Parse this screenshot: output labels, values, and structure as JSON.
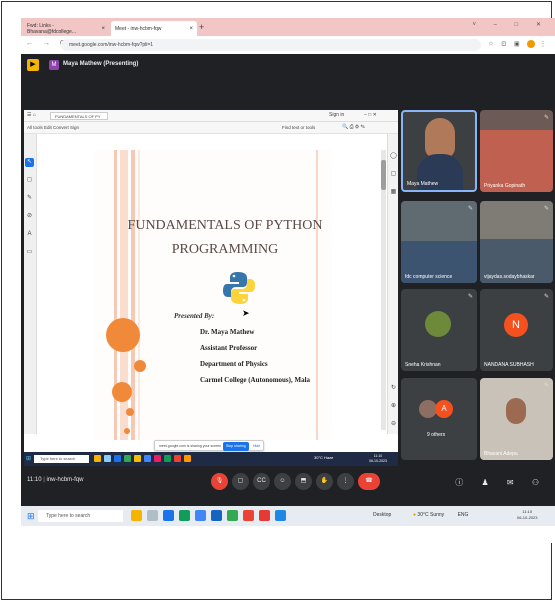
{
  "browser": {
    "tab1_title": "Fwd: Links - Bhavana@fdcollege...",
    "tab2_title": "Meet - inw-hcbm-fqw",
    "url": "meet.google.com/inw-hcbm-fqw?pli=1",
    "window_controls": "˅ – □ ✕"
  },
  "meet": {
    "presenter_initial": "M",
    "presenter_label": "Maya Mathew (Presenting)",
    "time": "11:10",
    "meeting_code": "inw-hcbm-fqw"
  },
  "pdf": {
    "tab_title": "FUNDAMENTALS OF PY",
    "signin": "Sign in",
    "menu": "All tools   Edit   Convert   Sign",
    "fit": "Find text or tools"
  },
  "slide": {
    "title_line1": "FUNDAMENTALS OF PYTHON",
    "title_line2": "PROGRAMMING",
    "presented_by": "Presented By:",
    "name": "Dr. Maya Mathew",
    "designation": "Assistant Professor",
    "department": "Department of Physics",
    "college": "Carmel College (Autonomous), Mala"
  },
  "sharebar": {
    "text": "meet.google.com is sharing your screen",
    "stop": "Stop sharing",
    "hide": "Hide"
  },
  "inner_taskbar": {
    "search": "Type here to search",
    "weather": "30°C Haze",
    "clock_time": "11:10",
    "clock_date": "06-10-2023"
  },
  "participants": [
    {
      "name": "Maya Mathew"
    },
    {
      "name": "Priyanka Gopinath"
    },
    {
      "name": "fdc computer science"
    },
    {
      "name": "vijaydas.sodaybhaskar"
    },
    {
      "name": "Sneha Krishnan"
    },
    {
      "name": "NANDANA SUBHASH",
      "initial": "N"
    },
    {
      "name": "9 others",
      "initial": "A"
    },
    {
      "name": "Bhavani Adepu"
    }
  ],
  "outer_taskbar": {
    "search": "Type here to search",
    "desktop": "Desktop",
    "weather": "30°C Sunny",
    "lang": "ENG",
    "clock_time": "11:10",
    "clock_date": "06-10-2023"
  },
  "colors": {
    "meet_bg": "#202124",
    "tile_bg": "#3c4043",
    "end_call": "#ea4335",
    "slide_accent": "#f08a3a"
  }
}
